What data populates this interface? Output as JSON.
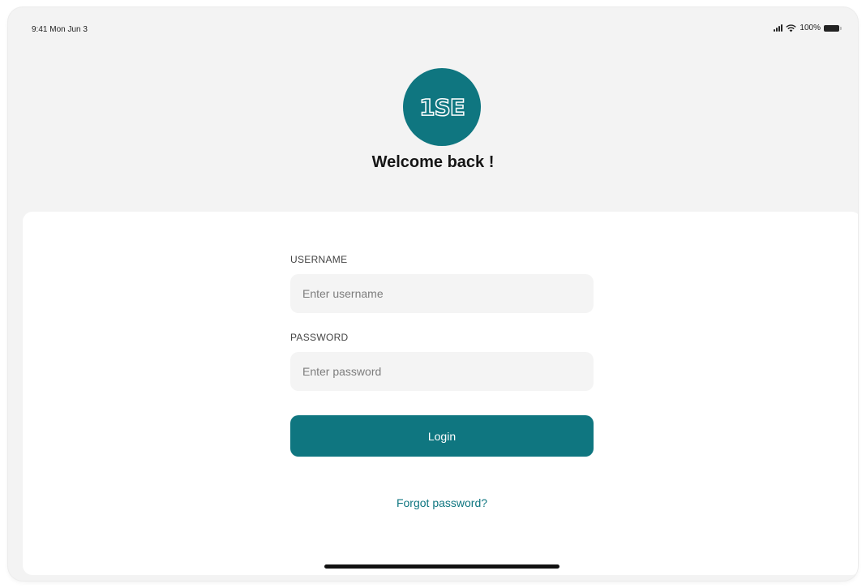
{
  "status_bar": {
    "time": "9:41 Mon Jun 3",
    "battery": "100%"
  },
  "logo": {
    "text": "1SE",
    "color": "#0f7680"
  },
  "welcome": {
    "title": "Welcome back !"
  },
  "form": {
    "username_label": "USERNAME",
    "username_placeholder": "Enter username",
    "username_value": "",
    "password_label": "PASSWORD",
    "password_placeholder": "Enter password",
    "password_value": "",
    "login_label": "Login",
    "forgot_label": "Forgot password?"
  },
  "colors": {
    "accent": "#0f7680",
    "background": "#f3f3f3",
    "card": "#ffffff",
    "input_bg": "#f4f4f4"
  },
  "icons": [
    "signal-icon",
    "wifi-icon",
    "battery-icon"
  ]
}
